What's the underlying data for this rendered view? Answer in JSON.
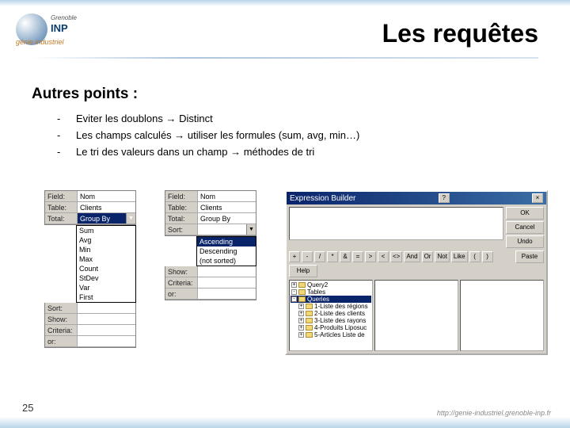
{
  "logo": {
    "top": "Grenoble",
    "main": "INP",
    "sub": "génie industriel"
  },
  "title": "Les requêtes",
  "subtitle": "Autres points :",
  "bullets": [
    "Eviter les doublons → Distinct",
    "Les champs calculés → utiliser les formules (sum, avg, min…)",
    "Le tri des valeurs dans un champ → méthodes de tri"
  ],
  "panel1": {
    "rows": [
      {
        "label": "Field:",
        "value": "Nom"
      },
      {
        "label": "Table:",
        "value": "Clients"
      },
      {
        "label": "Total:",
        "value": "Group By",
        "selected": true,
        "dropdown": true
      },
      {
        "label": "Sort:",
        "value": ""
      },
      {
        "label": "Show:",
        "value": ""
      },
      {
        "label": "Criteria:",
        "value": ""
      },
      {
        "label": "or:",
        "value": ""
      }
    ],
    "dropdown": [
      "Sum",
      "Avg",
      "Min",
      "Max",
      "Count",
      "StDev",
      "Var",
      "First"
    ]
  },
  "panel2": {
    "rows": [
      {
        "label": "Field:",
        "value": "Nom"
      },
      {
        "label": "Table:",
        "value": "Clients"
      },
      {
        "label": "Total:",
        "value": "Group By"
      },
      {
        "label": "Sort:",
        "value": "",
        "dropdown": true
      },
      {
        "label": "Show:",
        "value": ""
      },
      {
        "label": "Criteria:",
        "value": ""
      },
      {
        "label": "or:",
        "value": ""
      }
    ],
    "sortlist": [
      {
        "t": "Ascending",
        "sel": true
      },
      {
        "t": "Descending"
      },
      {
        "t": "(not sorted)"
      }
    ]
  },
  "expr": {
    "title": "Expression Builder",
    "btns": {
      "ok": "OK",
      "cancel": "Cancel",
      "undo": "Undo",
      "help": "Help",
      "paste": "Paste"
    },
    "ops": [
      "+",
      "-",
      "/",
      "*",
      "&",
      "=",
      ">",
      "<",
      "<>",
      "And",
      "Or",
      "Not",
      "Like",
      "(",
      ")"
    ],
    "tree": [
      {
        "t": "Query2",
        "exp": "+"
      },
      {
        "t": "Tables",
        "exp": "-"
      },
      {
        "t": "Queries",
        "exp": "-",
        "sel": true
      },
      {
        "t": "1-Liste des régions",
        "indent": 1,
        "exp": "+"
      },
      {
        "t": "2-Liste des clients",
        "indent": 1,
        "exp": "+"
      },
      {
        "t": "3-Liste des rayons",
        "indent": 1,
        "exp": "+"
      },
      {
        "t": "4-Produits Liposuc",
        "indent": 1,
        "exp": "+"
      },
      {
        "t": "5-Articles Liste de",
        "indent": 1,
        "exp": "+"
      }
    ]
  },
  "page_number": "25",
  "footer_url": "http://genie-industriel.grenoble-inp.fr"
}
